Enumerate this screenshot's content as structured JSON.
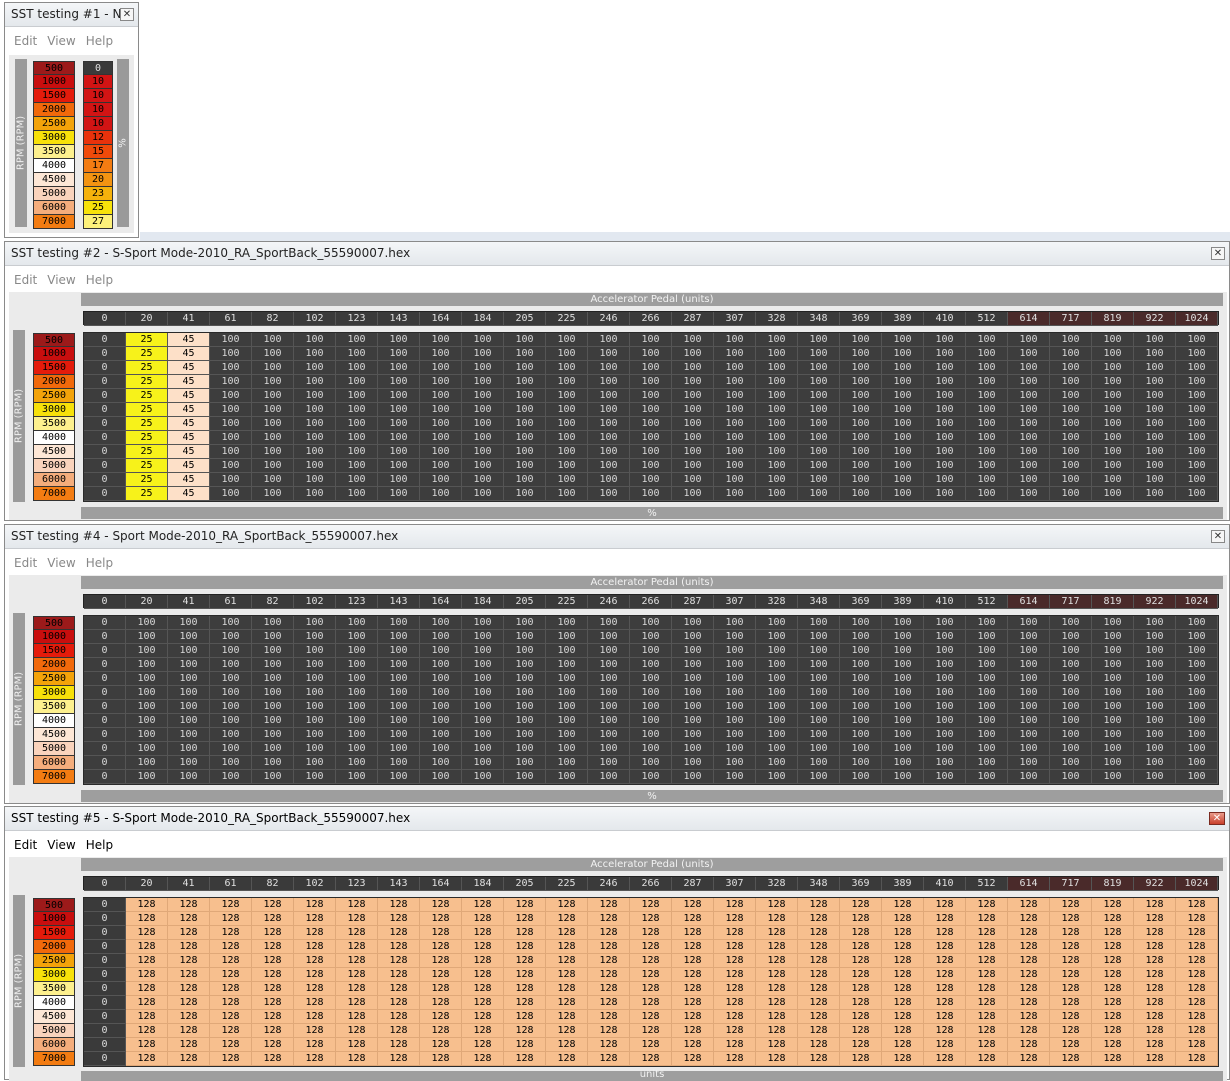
{
  "menu": [
    "Edit",
    "View",
    "Help"
  ],
  "rpm_axis_label": "RPM (RPM)",
  "rpm_values": [
    "500",
    "1000",
    "1500",
    "2000",
    "2500",
    "3000",
    "3500",
    "4000",
    "4500",
    "5000",
    "6000",
    "7000"
  ],
  "rpm_colors": [
    "#9c1a1a",
    "#c80e0e",
    "#e41b0b",
    "#f1690b",
    "#f3a30a",
    "#f7e10a",
    "#fdf08e",
    "#ffffff",
    "#fde7d6",
    "#f9d3bc",
    "#f4ad7c",
    "#f37c12"
  ],
  "pedal_axis_label": "Accelerator Pedal (units)",
  "pedal_values": [
    "0",
    "20",
    "41",
    "61",
    "82",
    "102",
    "123",
    "143",
    "164",
    "184",
    "205",
    "225",
    "246",
    "266",
    "287",
    "307",
    "328",
    "348",
    "369",
    "389",
    "410",
    "512",
    "614",
    "717",
    "819",
    "922",
    "1024"
  ],
  "windows": [
    {
      "id": "w1",
      "title": "SST testing #1 - N...",
      "side_label": "%",
      "values": [
        "0",
        "10",
        "10",
        "10",
        "10",
        "12",
        "15",
        "17",
        "20",
        "23",
        "25",
        "27"
      ],
      "value_colors": [
        "#3a3a3a",
        "#d21414",
        "#d21414",
        "#d21414",
        "#d21414",
        "#e8320c",
        "#f04a0a",
        "#f37c12",
        "#f39412",
        "#f5b20c",
        "#f7e20a",
        "#fdf17a"
      ]
    },
    {
      "id": "w2",
      "title": "SST testing #2 - S-Sport Mode-2010_RA_SportBack_55590007.hex",
      "bottom_label": "%",
      "row_values": [
        "0",
        "25",
        "45",
        "100",
        "100",
        "100",
        "100",
        "100",
        "100",
        "100",
        "100",
        "100",
        "100",
        "100",
        "100",
        "100",
        "100",
        "100",
        "100",
        "100",
        "100",
        "100",
        "100",
        "100",
        "100",
        "100",
        "100"
      ]
    },
    {
      "id": "w4",
      "title": "SST testing #4 - Sport Mode-2010_RA_SportBack_55590007.hex",
      "bottom_label": "%",
      "row_values": [
        "0",
        "100",
        "100",
        "100",
        "100",
        "100",
        "100",
        "100",
        "100",
        "100",
        "100",
        "100",
        "100",
        "100",
        "100",
        "100",
        "100",
        "100",
        "100",
        "100",
        "100",
        "100",
        "100",
        "100",
        "100",
        "100",
        "100"
      ]
    },
    {
      "id": "w5",
      "title": "SST testing #5 - S-Sport Mode-2010_RA_SportBack_55590007.hex",
      "bottom_label": "units",
      "row_values": [
        "0",
        "128",
        "128",
        "128",
        "128",
        "128",
        "128",
        "128",
        "128",
        "128",
        "128",
        "128",
        "128",
        "128",
        "128",
        "128",
        "128",
        "128",
        "128",
        "128",
        "128",
        "128",
        "128",
        "128",
        "128",
        "128",
        "128"
      ]
    }
  ],
  "close_glyph": "✕"
}
